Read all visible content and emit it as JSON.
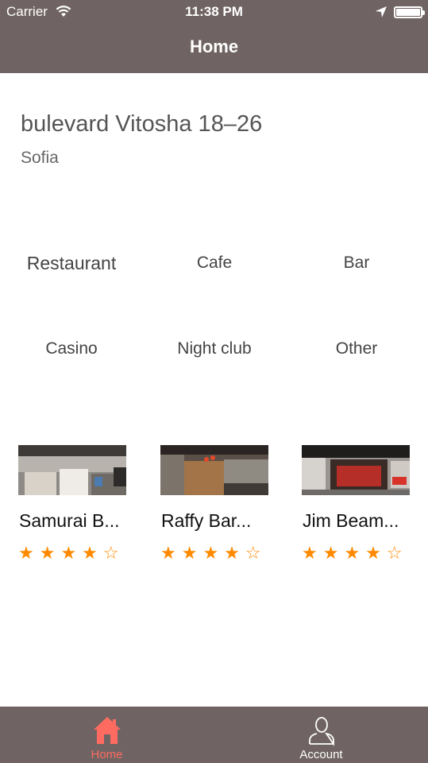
{
  "status_bar": {
    "carrier": "Carrier",
    "time": "11:38 PM"
  },
  "nav": {
    "title": "Home"
  },
  "location": {
    "address": "bulevard Vitosha 18–26",
    "city": "Sofia"
  },
  "categories": [
    "Restaurant",
    "Cafe",
    "Bar",
    "Casino",
    "Night club",
    "Other"
  ],
  "venues": [
    {
      "name": "Samurai B...",
      "rating": 4,
      "rating_text": "★★★★☆"
    },
    {
      "name": "Raffy Bar...",
      "rating": 4,
      "rating_text": "★★★★☆"
    },
    {
      "name": "Jim Beam...",
      "rating": 4,
      "rating_text": "★★★★☆"
    }
  ],
  "tabbar": {
    "home": {
      "label": "Home",
      "icon": "home-icon",
      "color": "#ff6b61"
    },
    "account": {
      "label": "Account",
      "icon": "person-icon",
      "color": "#ffffff"
    }
  },
  "colors": {
    "bar": "#6f6463",
    "star": "#ff8a00",
    "active_tab": "#ff6b61"
  }
}
